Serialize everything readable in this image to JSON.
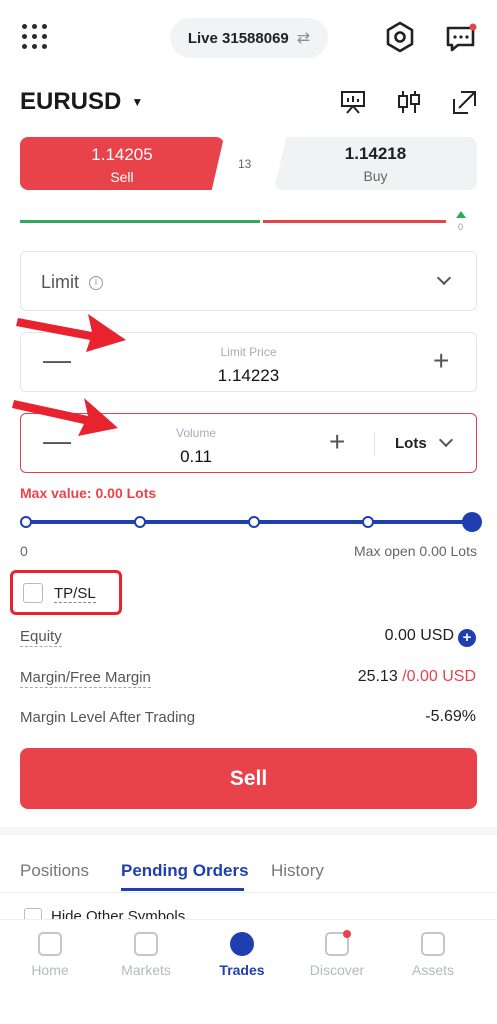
{
  "header": {
    "account_label": "Live 31588069",
    "icons": [
      "grid-menu-icon",
      "swap-icon",
      "settings-hex-icon",
      "message-icon"
    ]
  },
  "symbol": {
    "name": "EURUSD",
    "tools": [
      "chart-presentation-icon",
      "candlestick-icon",
      "expand-icon"
    ]
  },
  "quote": {
    "sell_price": "1.14205",
    "sell_label": "Sell",
    "spread": "13",
    "buy_price": "1.14218",
    "buy_label": "Buy",
    "sentiment_value": "0"
  },
  "order": {
    "type": "Limit",
    "info_glyph": "i",
    "limit_caption": "Limit Price",
    "limit_value": "1.14223",
    "volume_caption": "Volume",
    "volume_value": "0.11",
    "unit": "Lots",
    "max_value": "Max value: 0.00 Lots",
    "minus": "—",
    "plus": "+"
  },
  "slider": {
    "min_label": "0",
    "max_label": "Max open 0.00 Lots",
    "level": 1.0,
    "steps": 5
  },
  "tpsl": {
    "label": "TP/SL",
    "checked": false
  },
  "account": {
    "equity_label": "Equity",
    "equity_value": "0.00 USD",
    "margin_label": "Margin/Free Margin",
    "margin_value": "25.13",
    "margin_sep": " /",
    "free_margin_value": "0.00 USD",
    "level_label": "Margin Level After Trading",
    "level_value": "-5.69%"
  },
  "action": {
    "label": "Sell"
  },
  "tabs": {
    "items": [
      "Positions",
      "Pending Orders",
      "History"
    ],
    "active": "Pending Orders",
    "hide_other_label": "Hide Other Symbols"
  },
  "nav": {
    "items": [
      "Home",
      "Markets",
      "Trades",
      "Discover",
      "Assets"
    ],
    "active": "Trades"
  },
  "colors": {
    "sell": "#e8434a",
    "buy_bg": "#f1f2f4",
    "accent": "#1f3fb0",
    "buy_up": "#2eaa5a",
    "annotation": "#e8232f"
  }
}
